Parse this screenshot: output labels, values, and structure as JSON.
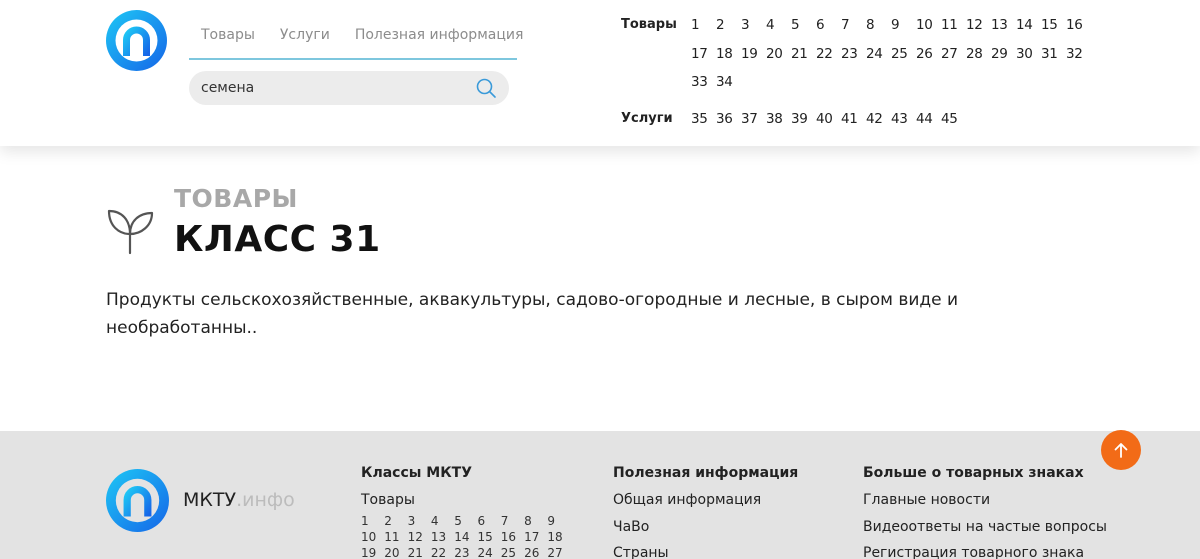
{
  "header": {
    "nav": [
      "Товары",
      "Услуги",
      "Полезная информация"
    ],
    "search": {
      "value": "семена",
      "icon": "search-icon"
    },
    "classes": {
      "goods_label": "Товары",
      "goods": [
        "1",
        "2",
        "3",
        "4",
        "5",
        "6",
        "7",
        "8",
        "9",
        "10",
        "11",
        "12",
        "13",
        "14",
        "15",
        "16",
        "17",
        "18",
        "19",
        "20",
        "21",
        "22",
        "23",
        "24",
        "25",
        "26",
        "27",
        "28",
        "29",
        "30",
        "31",
        "32",
        "33",
        "34"
      ],
      "services_label": "Услуги",
      "services": [
        "35",
        "36",
        "37",
        "38",
        "39",
        "40",
        "41",
        "42",
        "43",
        "44",
        "45"
      ]
    }
  },
  "main": {
    "kicker": "ТОВАРЫ",
    "title": "КЛАСС 31",
    "description": "Продукты сельскохозяйственные, аквакультуры, садово-огородные и лесные, в сыром виде и необработанны.."
  },
  "footer": {
    "brand": "МКТУ",
    "brand_suffix": ".инфо",
    "col1": {
      "title": "Классы МКТУ",
      "sub": "Товары",
      "nums": [
        "1",
        "2",
        "3",
        "4",
        "5",
        "6",
        "7",
        "8",
        "9",
        "10",
        "11",
        "12",
        "13",
        "14",
        "15",
        "16",
        "17",
        "18",
        "19",
        "20",
        "21",
        "22",
        "23",
        "24",
        "25",
        "26",
        "27"
      ]
    },
    "col2": {
      "title": "Полезная информация",
      "links": [
        "Общая информация",
        "ЧаВо",
        "Страны"
      ]
    },
    "col3": {
      "title": "Больше о товарных знаках",
      "links": [
        "Главные новости",
        "Видеоответы на частые вопросы",
        "Регистрация товарного знака"
      ]
    }
  },
  "colors": {
    "accent_blue": "#1a8cf0",
    "accent_orange": "#f26b17",
    "nav_underline": "#7ec7de"
  }
}
